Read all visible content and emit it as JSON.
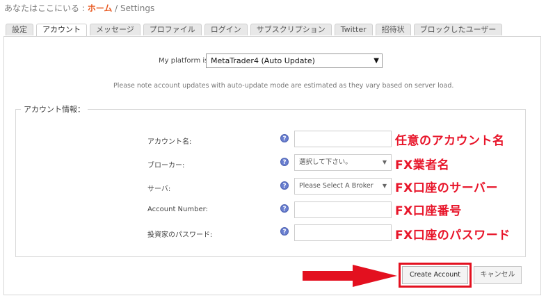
{
  "breadcrumb": {
    "prefix": "あなたはここにいる : ",
    "home": "ホーム",
    "current": " / Settings"
  },
  "tabs": [
    "設定",
    "アカウント",
    "メッセージ",
    "プロファイル",
    "ログイン",
    "サブスクリプション",
    "Twitter",
    "招待状",
    "ブロックしたユーザー"
  ],
  "platform": {
    "label": "My platform is:",
    "value": "MetaTrader4 (Auto Update)"
  },
  "note": "Please note account updates with auto-update mode are estimated as they vary based on server load.",
  "account_info": {
    "legend": "アカウント情報：",
    "rows": [
      {
        "label": "アカウント名:",
        "value": "",
        "annotation": "任意のアカウント名"
      },
      {
        "label": "ブローカー:",
        "value": "選択して下さい。",
        "annotation": "FX業者名"
      },
      {
        "label": "サーバ:",
        "value": "Please Select A Broker",
        "annotation": "FX口座のサーバー"
      },
      {
        "label": "Account Number:",
        "value": "",
        "annotation": "FX口座番号"
      },
      {
        "label": "投資家のパスワード:",
        "value": "",
        "annotation": "FX口座のパスワード"
      }
    ],
    "help_glyph": "?"
  },
  "buttons": {
    "create": "Create Account",
    "cancel": "キャンセル"
  },
  "colors": {
    "accent": "#e8581f",
    "annotation": "#e8152a",
    "help": "#6a7fd0"
  }
}
